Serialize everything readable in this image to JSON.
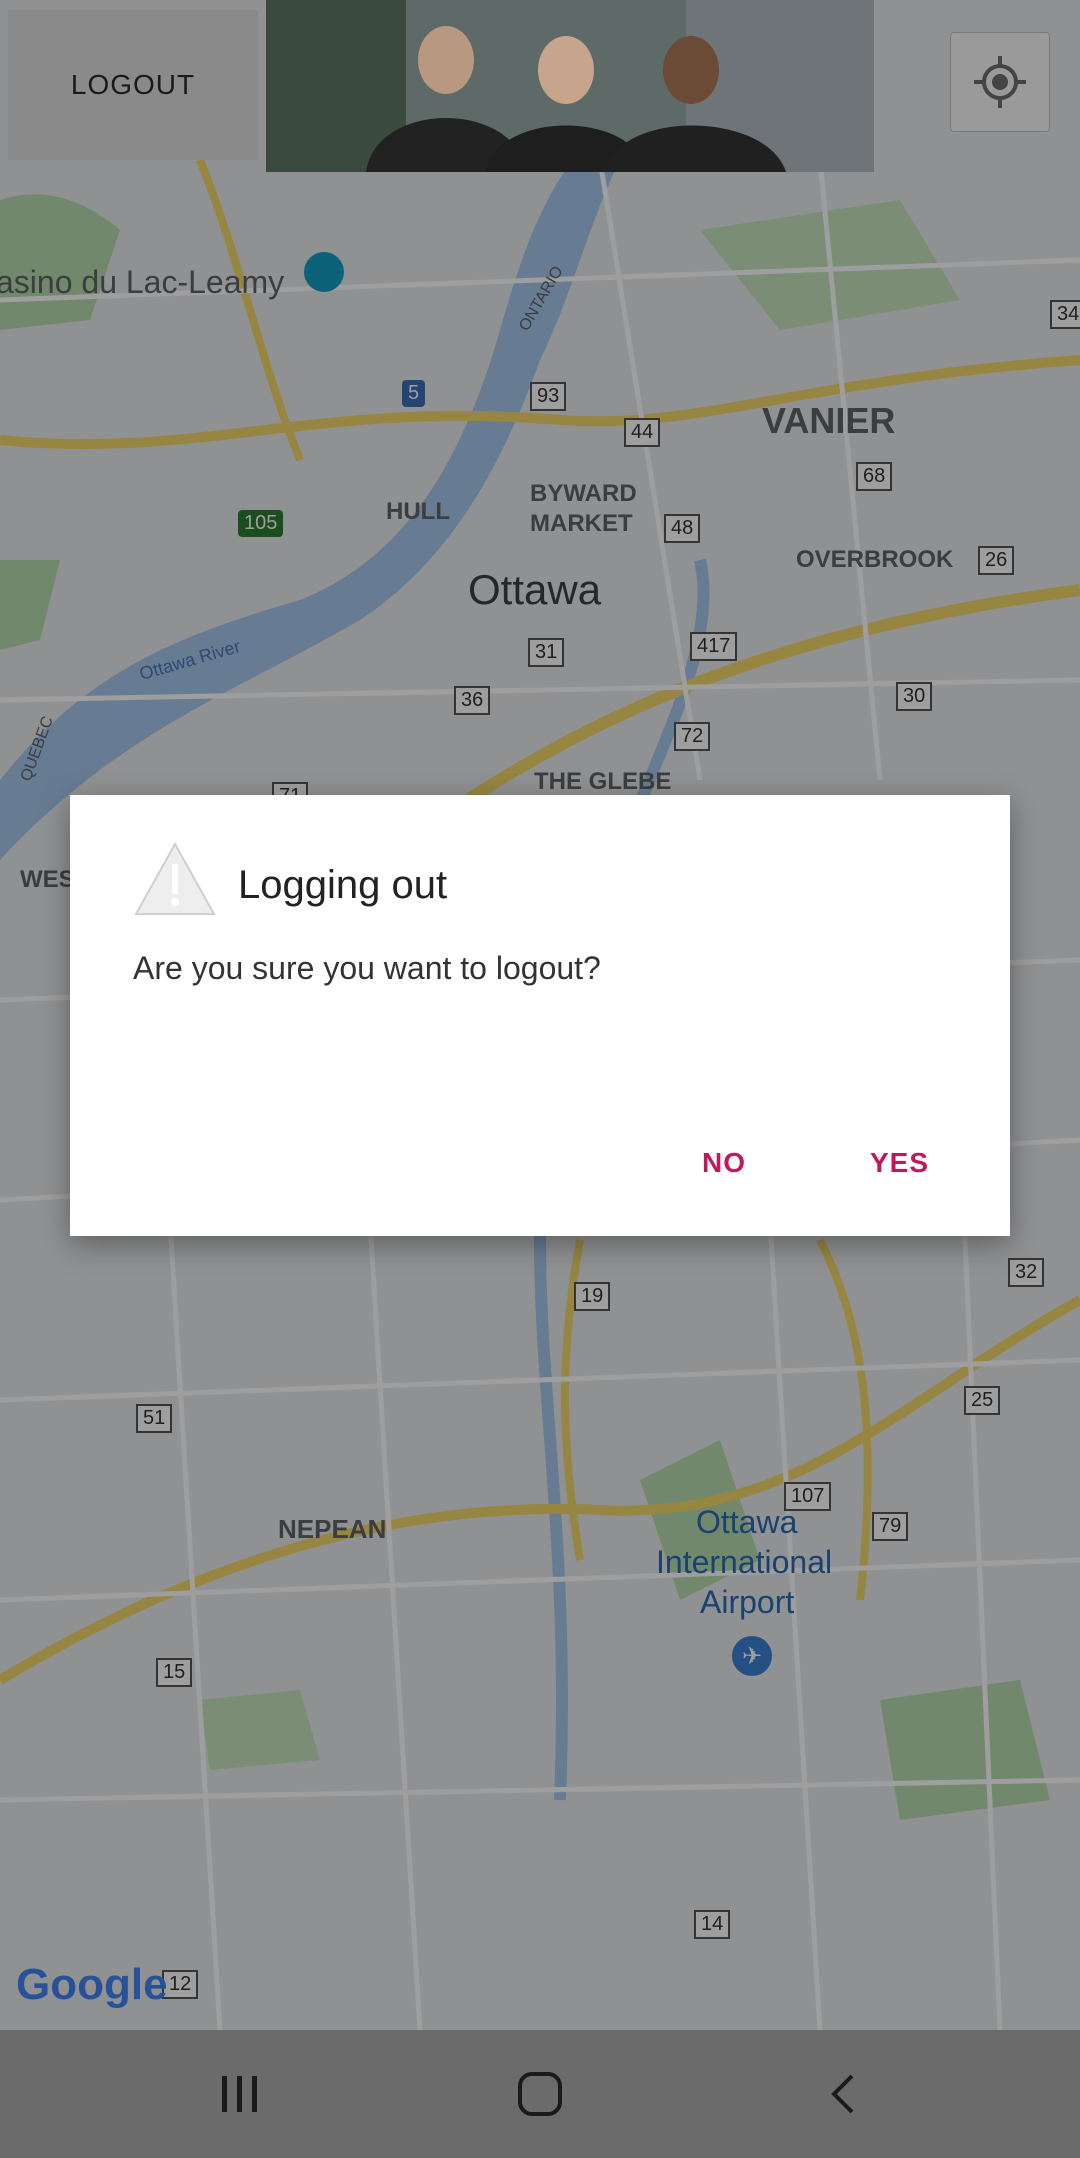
{
  "header": {
    "logout_label": "LOGOUT"
  },
  "map": {
    "labels": [
      {
        "key": "casino",
        "text": "asino du Lac-Leamy"
      },
      {
        "key": "vanier",
        "text": "VANIER"
      },
      {
        "key": "hull",
        "text": "HULL"
      },
      {
        "key": "byward",
        "text": "BYWARD"
      },
      {
        "key": "market",
        "text": "MARKET"
      },
      {
        "key": "overbrook",
        "text": "OVERBROOK"
      },
      {
        "key": "ottawa",
        "text": "Ottawa"
      },
      {
        "key": "ottawa_river",
        "text": "Ottawa River"
      },
      {
        "key": "glebe",
        "text": "THE GLEBE"
      },
      {
        "key": "nepean",
        "text": "NEPEAN"
      },
      {
        "key": "airport1",
        "text": "Ottawa"
      },
      {
        "key": "airport2",
        "text": "International"
      },
      {
        "key": "airport3",
        "text": "Airport"
      },
      {
        "key": "quebec",
        "text": "QUEBEC"
      },
      {
        "key": "ontario",
        "text": "ONTARIO"
      },
      {
        "key": "wes",
        "text": "WES"
      }
    ],
    "routes": [
      "5",
      "93",
      "44",
      "105",
      "68",
      "48",
      "26",
      "417",
      "31",
      "36",
      "30",
      "72",
      "71",
      "19",
      "32",
      "51",
      "107",
      "79",
      "25",
      "15",
      "14",
      "12",
      "34"
    ],
    "attribution": "Google"
  },
  "dialog": {
    "title": "Logging out",
    "message": "Are you sure you want to logout?",
    "no_label": "NO",
    "yes_label": "YES",
    "accent_color": "#c2185b"
  },
  "navbar": {
    "recent_icon": "recent-apps-icon",
    "home_icon": "home-icon",
    "back_icon": "back-icon"
  }
}
